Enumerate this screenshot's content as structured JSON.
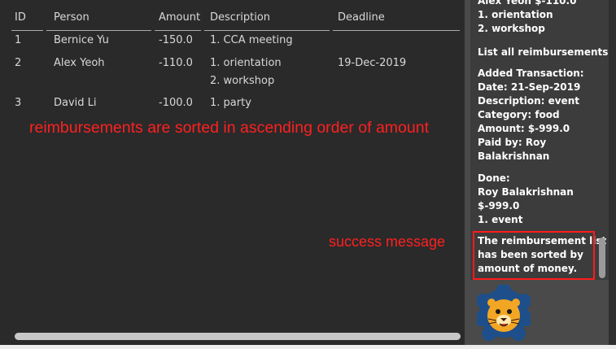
{
  "table": {
    "headers": [
      "ID",
      "Person",
      "Amount",
      "Description",
      "Deadline"
    ],
    "rows": [
      {
        "id": "1",
        "person": "Bernice Yu",
        "amount": "-150.0",
        "desc1": "1. CCA meeting",
        "desc2": "",
        "deadline": ""
      },
      {
        "id": "2",
        "person": "Alex Yeoh",
        "amount": "-110.0",
        "desc1": "1. orientation",
        "desc2": "2. workshop",
        "deadline": "19-Dec-2019"
      },
      {
        "id": "3",
        "person": "David Li",
        "amount": "-100.0",
        "desc1": "1. party",
        "desc2": "",
        "deadline": ""
      }
    ]
  },
  "annotations": {
    "sorted_note": "reimbursements are sorted in ascending order of amount",
    "success_note": "success message"
  },
  "sidebar": {
    "messages": [
      {
        "text": "Alex Yeoh $-110.0\n1. orientation\n2. workshop"
      },
      {
        "text": "List all reimbursements."
      },
      {
        "text": "Added Transaction:\nDate: 21-Sep-2019\nDescription: event\nCategory: food\nAmount: $-999.0\nPaid by: Roy\nBalakrishnan"
      },
      {
        "text": "Done:\nRoy Balakrishnan\n$-999.0\n1. event"
      },
      {
        "text": "The reimbursement list\nhas been sorted by\namount of money."
      }
    ]
  },
  "colors": {
    "annotation": "#ff2020",
    "highlight_box": "#ff1a1a",
    "lion_face": "#f3a623",
    "lion_mane": "#1e4f8a"
  },
  "icons": {
    "mascot": "lion-icon"
  }
}
